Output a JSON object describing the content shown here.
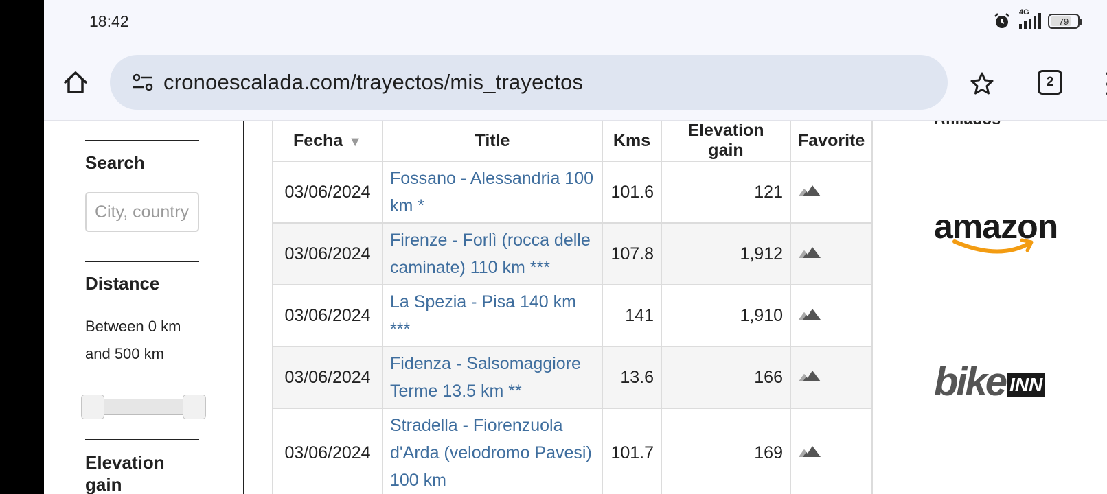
{
  "status_bar": {
    "time": "18:42",
    "network": "4G",
    "battery": "79",
    "battery_level": 0.79,
    "icons": [
      "alarm-icon",
      "signal-icon",
      "battery-icon"
    ]
  },
  "browser": {
    "url": "cronoescalada.com/trayectos/mis_trayectos",
    "tab_count": "2",
    "icons": [
      "home-icon",
      "site-settings-icon",
      "star-icon",
      "tabs-icon",
      "more-vert-icon"
    ]
  },
  "sidebar": {
    "search_title": "Search",
    "search_placeholder": "City, country",
    "distance_title": "Distance",
    "distance_text": "Between 0 km and 500 km",
    "distance_min": 0,
    "distance_max": 500,
    "elevation_title": "Elevation gain"
  },
  "table": {
    "headers": {
      "fecha": "Fecha",
      "sort_indicator": "▼",
      "title": "Title",
      "kms": "Kms",
      "elevation": "Elevation gain",
      "favorite": "Favorite"
    },
    "favorite_icon": "mountain-icon",
    "rows": [
      {
        "fecha": "03/06/2024",
        "title": "Fossano - Alessandria 100 km *",
        "kms": "101.6",
        "elevation": "121"
      },
      {
        "fecha": "03/06/2024",
        "title": "Firenze - Forlì (rocca delle caminate) 110 km ***",
        "kms": "107.8",
        "elevation": "1,912"
      },
      {
        "fecha": "03/06/2024",
        "title": "La Spezia - Pisa 140 km ***",
        "kms": "141",
        "elevation": "1,910"
      },
      {
        "fecha": "03/06/2024",
        "title": "Fidenza - Salsomaggiore Terme 13.5 km **",
        "kms": "13.6",
        "elevation": "166"
      },
      {
        "fecha": "03/06/2024",
        "title": "Stradella - Fiorenzuola d'Arda (velodromo Pavesi) 100 km",
        "kms": "101.7",
        "elevation": "169"
      }
    ]
  },
  "aside": {
    "title": "Afiliados",
    "amazon": "amazon",
    "bike": "bike",
    "inn": "INN",
    "accent_amazon": "#f39c12"
  }
}
